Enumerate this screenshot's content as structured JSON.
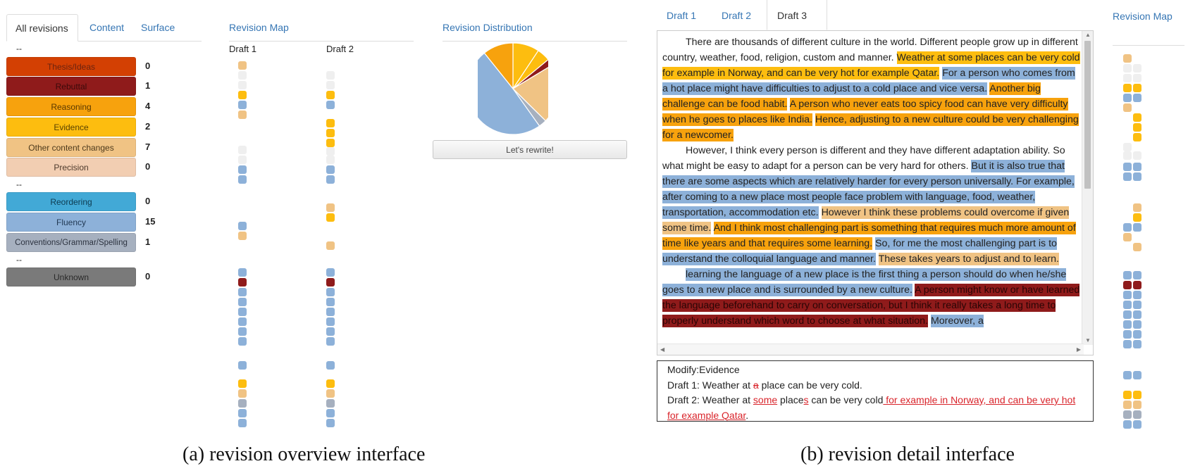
{
  "overview": {
    "tabs": [
      "All revisions",
      "Content",
      "Surface"
    ],
    "active_tab": 0,
    "revision_map_title": "Revision Map",
    "distribution_title": "Revision Distribution",
    "separator": "--",
    "categories": [
      {
        "label": "Thesis/Ideas",
        "count": "0",
        "color": "#d34003",
        "text_color": "#6a2310"
      },
      {
        "label": "Rebuttal",
        "count": "1",
        "color": "#8f1b1b",
        "text_color": "#3a0a0a"
      },
      {
        "label": "Reasoning",
        "count": "4",
        "color": "#f7a20d",
        "text_color": "#5a3800"
      },
      {
        "label": "Evidence",
        "count": "2",
        "color": "#fdbd0f",
        "text_color": "#5a4200"
      },
      {
        "label": "Other content changes",
        "count": "7",
        "color": "#f0c384",
        "text_color": "#4d3a1c"
      },
      {
        "label": "Precision",
        "count": "0",
        "color": "#f2ceb2",
        "text_color": "#4d3a2c"
      },
      {
        "label": "Reordering",
        "count": "0",
        "color": "#42a9d6",
        "text_color": "#0e3b50"
      },
      {
        "label": "Fluency",
        "count": "15",
        "color": "#8db1d9",
        "text_color": "#223a55"
      },
      {
        "label": "Conventions/Grammar/Spelling",
        "count": "1",
        "color": "#a6b0bf",
        "text_color": "#2d3340"
      },
      {
        "label": "Unknown",
        "count": "0",
        "color": "#7a7a7a",
        "text_color": "#2a2a2a"
      }
    ],
    "draft_labels": [
      "Draft 1",
      "Draft 2"
    ],
    "rewrite_label": "Let's rewrite!",
    "pie_slices": [
      {
        "name": "Evidence",
        "value": 2,
        "color": "#fdbd0f"
      },
      {
        "name": "Evidence",
        "value": 1,
        "color": "#fdbd0f"
      },
      {
        "name": "Rebuttal",
        "value": 0.5,
        "color": "#8f1b1b"
      },
      {
        "name": "Other content changes",
        "value": 4.5,
        "color": "#f0c384"
      },
      {
        "name": "Conventions/Grammar/Spelling",
        "value": 0.6,
        "color": "#a6b0bf"
      },
      {
        "name": "Fluency",
        "value": 10.5,
        "color": "#8db1d9"
      },
      {
        "name": "Reasoning",
        "value": 2.3,
        "color": "#f7a20d"
      }
    ]
  },
  "detail": {
    "tabs": [
      "Draft 1",
      "Draft 2",
      "Draft 3"
    ],
    "active_tab": 2,
    "revision_map_title": "Revision Map",
    "info_title": "Modify:Evidence",
    "draft1_prefix": "Draft 1:",
    "draft1_a": " Weather at ",
    "draft1_del": "a",
    "draft1_b": " place can be very cold.",
    "draft2_prefix": "Draft 2:",
    "draft2_a": " Weather at ",
    "draft2_ins1": "some",
    "draft2_b": " place",
    "draft2_ins2": "s",
    "draft2_c": " can be very cold",
    "draft2_ins3": " for example in Norway, and can be very hot for example Qatar",
    "draft2_d": ".",
    "paragraphs": [
      [
        {
          "t": "There are thousands of different culture in the world. Different people grow up in different country, weather, food, religion, custom and manner. ",
          "c": ""
        },
        {
          "t": "Weather at some places can be very cold for example in Norway, and can be very hot for example Qatar.",
          "c": "#fdbd0f"
        },
        {
          "t": " ",
          "c": ""
        },
        {
          "t": "For a person who comes from a hot place might have difficulties to adjust to a cold place and vice versa.",
          "c": "#8db1d9"
        },
        {
          "t": " ",
          "c": ""
        },
        {
          "t": "Another big challenge can be food habit.",
          "c": "#f7a20d"
        },
        {
          "t": " ",
          "c": ""
        },
        {
          "t": "A person who never eats too spicy food can have very difficulty when he goes to places like India.",
          "c": "#f7a20d"
        },
        {
          "t": " ",
          "c": ""
        },
        {
          "t": "Hence, adjusting to a new culture could be very challenging for a newcomer.",
          "c": "#f7a20d"
        }
      ],
      [
        {
          "t": "However, I think every person is different and they have different adaptation ability. So what might be easy to adapt for a person can be very hard for others. ",
          "c": ""
        },
        {
          "t": "But it is also true that there are some aspects which are relatively harder for every person universally. For example, after coming to a new place most people face problem with language, food, weather, transportation, accommodation etc.",
          "c": "#8db1d9"
        },
        {
          "t": " ",
          "c": ""
        },
        {
          "t": "However I think these problems could overcome if given some time.",
          "c": "#f0c384"
        },
        {
          "t": " ",
          "c": ""
        },
        {
          "t": "And I think most challenging part is something that requires much more amount of time like years and that requires some learning.",
          "c": "#f7a20d"
        },
        {
          "t": " ",
          "c": ""
        },
        {
          "t": "So, for me the most challenging part is to understand the colloquial language and manner.",
          "c": "#8db1d9"
        },
        {
          "t": " ",
          "c": ""
        },
        {
          "t": "These takes years to adjust and to learn.",
          "c": "#f0c384"
        }
      ],
      [
        {
          "t": "learning the language of a new place is the first thing a person should do when he/she goes to a new place and is surrounded by a new culture.",
          "c": "#8db1d9"
        },
        {
          "t": " ",
          "c": ""
        },
        {
          "t": "A person might know or have learned the language beforehand to carry on conversation, but I think it really takes a long time to properly understand which word to choose at what situation.",
          "c": "#8f1b1b"
        },
        {
          "t": " ",
          "c": ""
        },
        {
          "t": "Moreover, a",
          "c": "#8db1d9"
        }
      ]
    ]
  },
  "captions": {
    "left": "(a)  revision overview interface",
    "right": "(b)  revision detail interface"
  }
}
